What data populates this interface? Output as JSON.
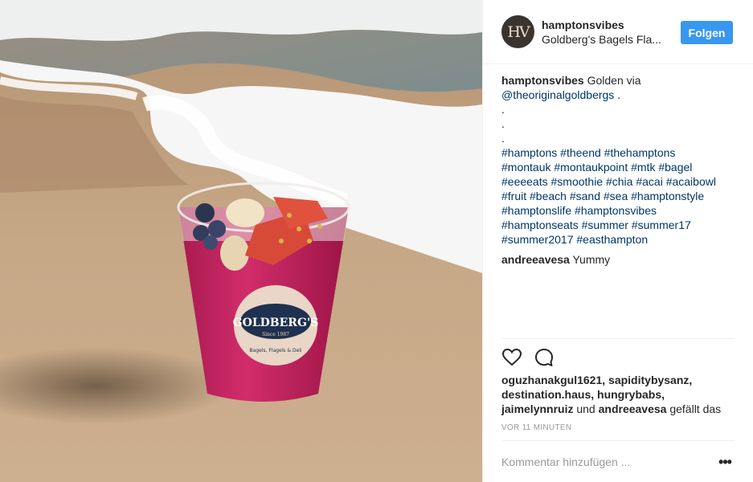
{
  "header": {
    "avatar_initials": "HV",
    "username": "hamptonsvibes",
    "location": "Goldberg's Bagels Fla...",
    "follow_label": "Folgen"
  },
  "photo": {
    "cup_brand": "GOLDBERG'S",
    "cup_since": "Since 1987",
    "cup_tagline": "Bagels, Flagels & Deli"
  },
  "caption": {
    "username": "hamptonsvibes",
    "text": "Golden via",
    "mention": "@theoriginalgoldbergs",
    "after_mention": " .",
    "dots": [
      ".",
      ".",
      "."
    ],
    "hashtags": [
      "#hamptons #theend #thehamptons",
      "#montauk #montaukpoint #mtk #bagel",
      "#eeeeats #smoothie #chia #acai #acaibowl",
      "#fruit #beach #sand #sea #hamptonstyle",
      "#hamptonslife #hamptonsvibes",
      "#hamptonseats #summer #summer17",
      "#summer2017 #easthampton"
    ]
  },
  "comments": [
    {
      "username": "andreeavesa",
      "text": "Yummy"
    }
  ],
  "actions": {
    "like_icon": "heart-icon",
    "comment_icon": "speech-bubble-icon"
  },
  "likes": {
    "users_line1": "oguzhanakgul1621, sapiditybysanz,",
    "users_line2": "destination.haus, hungrybabs,",
    "user_line3": "jaimelynnruiz",
    "conjunction": " und ",
    "last_user": "andreeavesa",
    "suffix": " gefällt das"
  },
  "timestamp": "VOR 11 MINUTEN",
  "comment_input": {
    "placeholder": "Kommentar hinzufügen ...",
    "value": ""
  },
  "more_label": "•••",
  "colors": {
    "follow_button": "#3897f0",
    "link": "#003569",
    "muted": "#999999",
    "cup": "#c4265f"
  }
}
